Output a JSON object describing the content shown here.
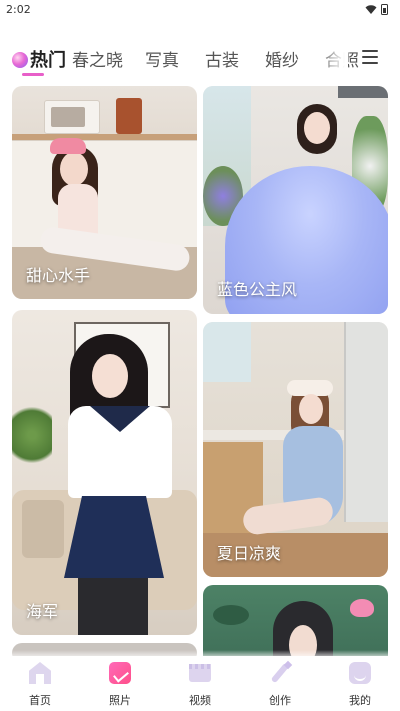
{
  "status_bar": {
    "time": "2:02"
  },
  "tabs": [
    {
      "label": "热门",
      "active": true
    },
    {
      "label": "春之晓",
      "active": false
    },
    {
      "label": "写真",
      "active": false
    },
    {
      "label": "古装",
      "active": false
    },
    {
      "label": "婚纱",
      "active": false
    },
    {
      "label": "合照",
      "active": false
    }
  ],
  "cards": [
    {
      "label": "甜心水手"
    },
    {
      "label": "蓝色公主风"
    },
    {
      "label": "海军"
    },
    {
      "label": "夏日凉爽"
    },
    {
      "label": ""
    },
    {
      "label": ""
    }
  ],
  "bottom_nav": [
    {
      "label": "首页",
      "icon": "home-icon"
    },
    {
      "label": "照片",
      "icon": "photos-icon",
      "active": true
    },
    {
      "label": "视频",
      "icon": "video-icon"
    },
    {
      "label": "创作",
      "icon": "create-icon"
    },
    {
      "label": "我的",
      "icon": "profile-icon"
    }
  ],
  "colors": {
    "accent": "#e85fc9",
    "active_nav": "#ff5a9e"
  }
}
